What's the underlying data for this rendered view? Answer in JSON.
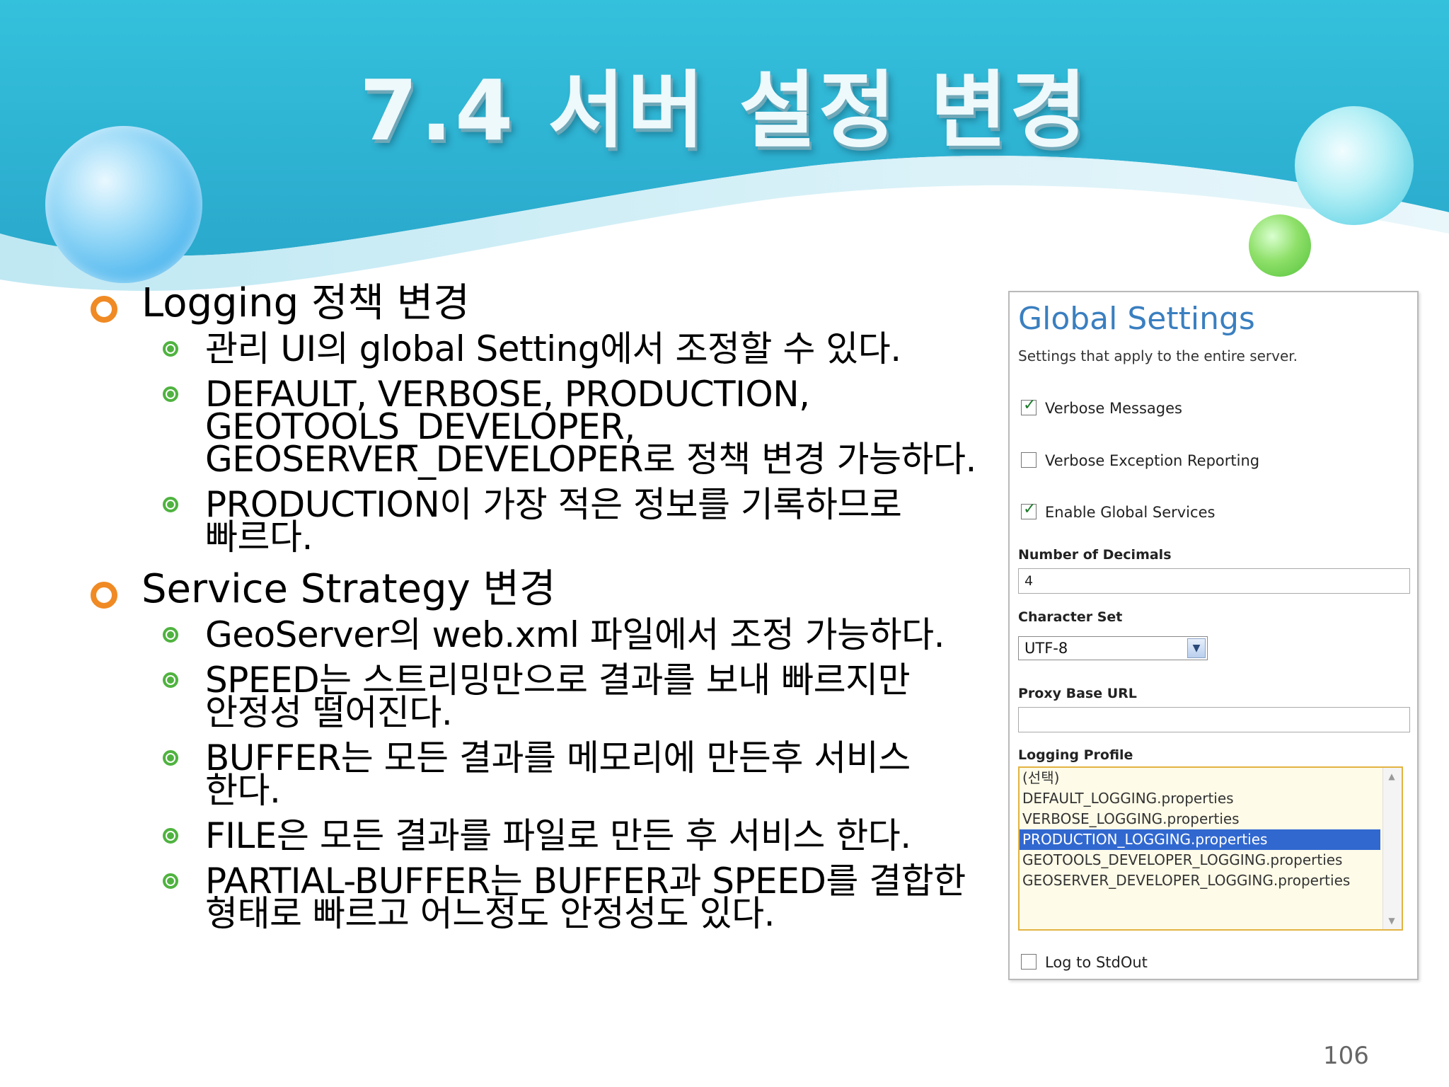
{
  "slide": {
    "title": "7.4 서버 설정 변경",
    "page_number": "106"
  },
  "sections": [
    {
      "heading": "Logging 정책 변경",
      "items": [
        [
          "관리 UI의 global Setting에서 조정할 수 있다."
        ],
        [
          "DEFAULT, VERBOSE, PRODUCTION,",
          "GEOTOOLS_DEVELOPER,",
          "GEOSERVER_DEVELOPER로 정책 변경 가능하다."
        ],
        [
          "PRODUCTION이 가장 적은 정보를 기록하므로",
          "빠르다."
        ]
      ]
    },
    {
      "heading": "Service Strategy 변경",
      "items": [
        [
          "GeoServer의 web.xml 파일에서 조정 가능하다."
        ],
        [
          "SPEED는 스트리밍만으로 결과를 보내 빠르지만",
          "안정성 떨어진다."
        ],
        [
          "BUFFER는 모든 결과를 메모리에 만든후 서비스",
          "한다."
        ],
        [
          "FILE은 모든 결과를 파일로 만든 후 서비스 한다."
        ],
        [
          "PARTIAL-BUFFER는 BUFFER과 SPEED를 결합한",
          "형태로 빠르고 어느정도 안정성도 있다."
        ]
      ]
    }
  ],
  "global_settings": {
    "title": "Global Settings",
    "subtitle": "Settings that apply to the entire server.",
    "verbose_messages": {
      "label": "Verbose Messages",
      "checked": true
    },
    "verbose_exception": {
      "label": "Verbose Exception Reporting",
      "checked": false
    },
    "enable_global_services": {
      "label": "Enable Global Services",
      "checked": true
    },
    "number_of_decimals": {
      "label": "Number of Decimals",
      "value": "4"
    },
    "character_set": {
      "label": "Character Set",
      "value": "UTF-8"
    },
    "proxy_base_url": {
      "label": "Proxy Base URL",
      "value": ""
    },
    "logging_profile": {
      "label": "Logging Profile",
      "options": [
        "(선택)",
        "DEFAULT_LOGGING.properties",
        "VERBOSE_LOGGING.properties",
        "PRODUCTION_LOGGING.properties",
        "GEOTOOLS_DEVELOPER_LOGGING.properties",
        "GEOSERVER_DEVELOPER_LOGGING.properties"
      ],
      "selected_index": 3
    },
    "log_to_stdout": {
      "label": "Log to StdOut",
      "checked": false
    }
  }
}
